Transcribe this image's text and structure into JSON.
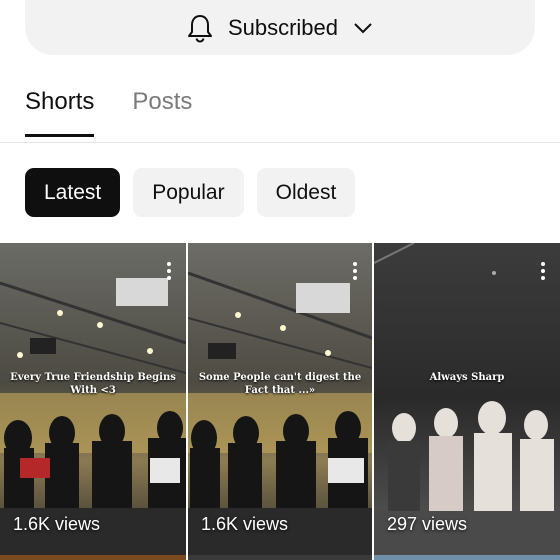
{
  "subscription": {
    "label": "Subscribed",
    "bell_icon": "bell-icon",
    "chevron_icon": "chevron-down-icon"
  },
  "tabs": [
    {
      "label": "Shorts",
      "active": true
    },
    {
      "label": "Posts",
      "active": false
    }
  ],
  "filters": [
    {
      "label": "Latest",
      "selected": true
    },
    {
      "label": "Popular",
      "selected": false
    },
    {
      "label": "Oldest",
      "selected": false
    }
  ],
  "shorts": [
    {
      "caption": "Every True Friendship Begins With <3",
      "views": "1.6K views"
    },
    {
      "caption": "Some People can't digest the Fact that ...»",
      "views": "1.6K views"
    },
    {
      "caption": "Always Sharp",
      "views": "297 views"
    }
  ],
  "colors": {
    "chip_selected": "#0f0f0f",
    "chip_default": "#f2f2f2",
    "tab_inactive": "#7a7a7a"
  }
}
